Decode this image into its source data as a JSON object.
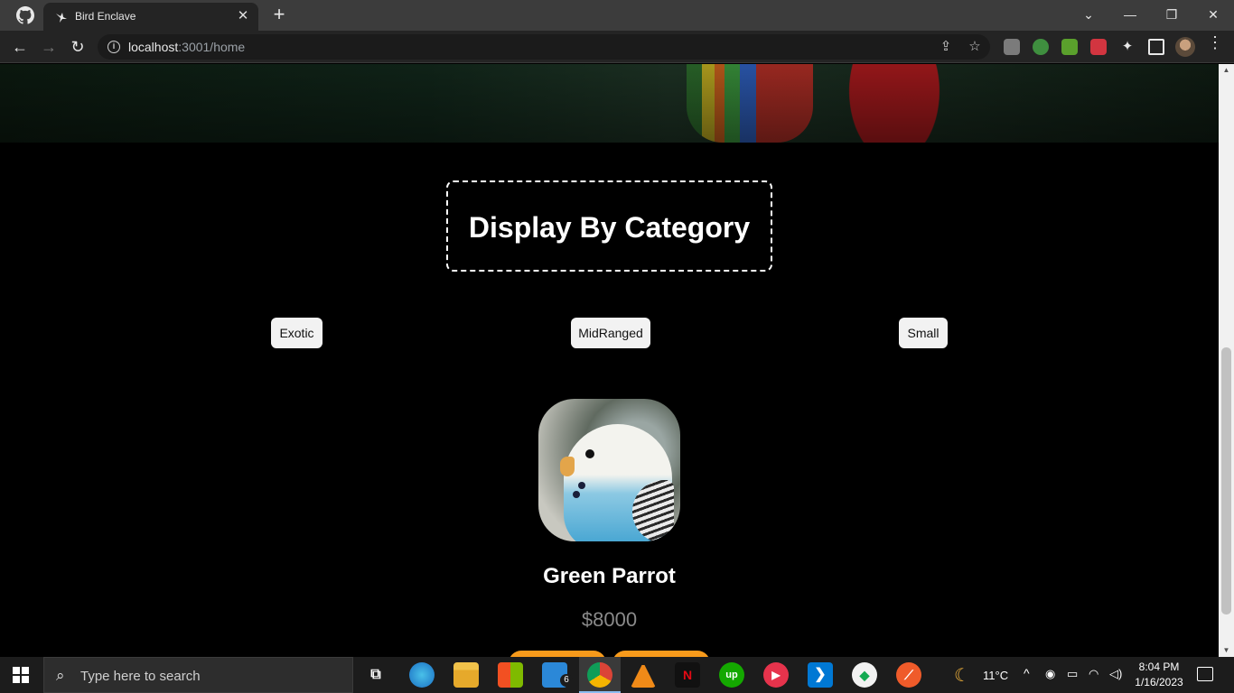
{
  "browser": {
    "tab_title": "Bird Enclave",
    "tab_close_glyph": "✕",
    "new_tab_glyph": "+",
    "url_host": "localhost",
    "url_path": ":3001/home",
    "window_controls": [
      "⌄",
      "—",
      "❐",
      "✕"
    ]
  },
  "page": {
    "section_title": "Display By Category",
    "categories": [
      "Exotic",
      "MidRanged",
      "Small"
    ],
    "product": {
      "name": "Green Parrot",
      "price": "$8000"
    },
    "accent_color": "#f79a1b"
  },
  "taskbar": {
    "search_placeholder": "Type here to search",
    "mail_badge": "6",
    "weather": "11°C",
    "time": "8:04 PM",
    "date": "1/16/2023"
  }
}
